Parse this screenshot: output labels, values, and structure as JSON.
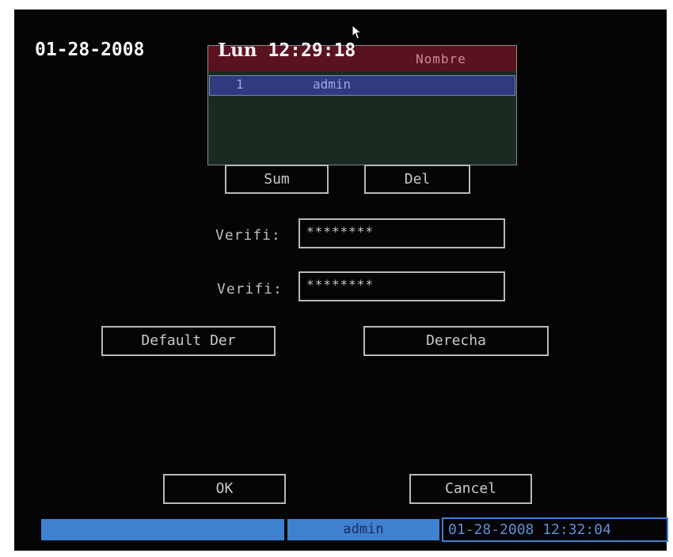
{
  "osd": {
    "date": "01-28-2008",
    "day": "Lun",
    "time": "12:29:18"
  },
  "user_list": {
    "header": "Nombre",
    "rows": [
      {
        "index": "1",
        "name": "admin"
      }
    ]
  },
  "buttons": {
    "add": "Sum",
    "delete": "Del",
    "default_rights": "Default Der",
    "rights": "Derecha",
    "ok": "OK",
    "cancel": "Cancel"
  },
  "fields": {
    "password1_label": "Verifi:",
    "password1_value": "********",
    "password2_label": "Verifi:",
    "password2_value": "********"
  },
  "status_bar": {
    "user": "admin",
    "datetime": "01-28-2008 12:32:04",
    "color": "#3f80d0"
  },
  "icons": {
    "cursor": "mouse-pointer-icon"
  }
}
